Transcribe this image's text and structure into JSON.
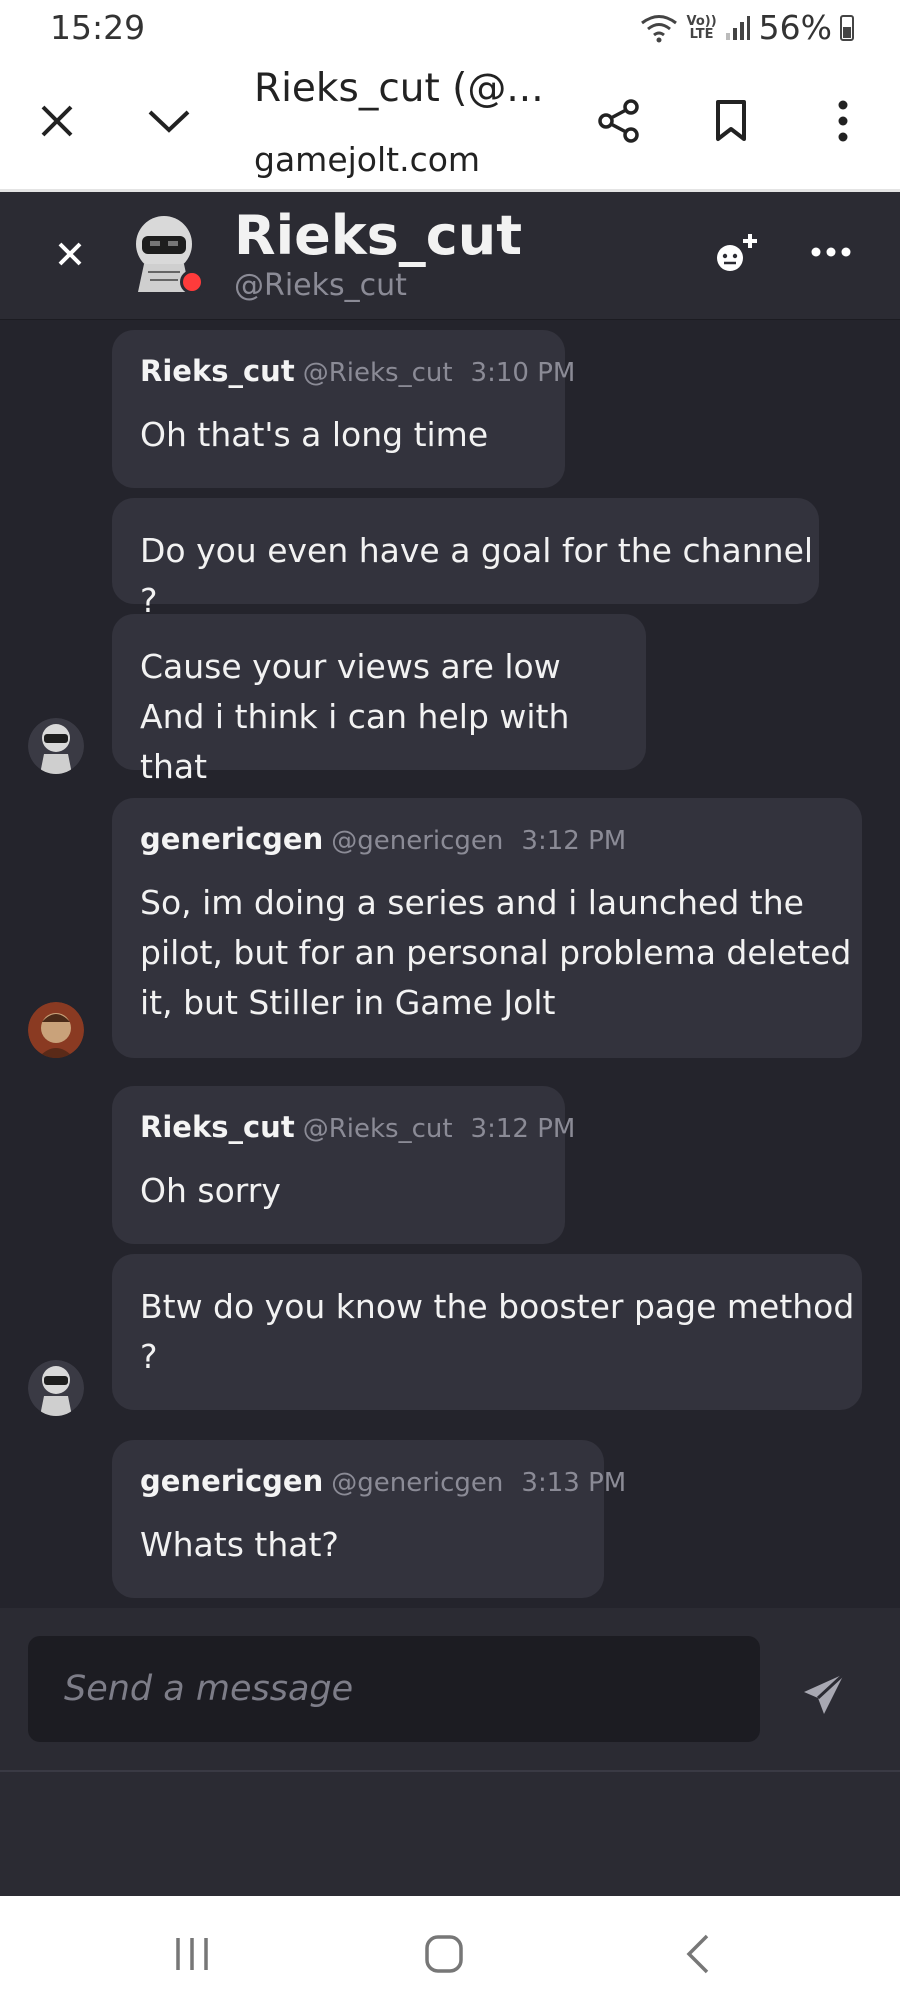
{
  "status_bar": {
    "time": "15:29",
    "network_label_top": "Vo))",
    "network_label_bottom": "LTE",
    "battery": "56%"
  },
  "browser": {
    "title": "Rieks_cut (@...",
    "url": "gamejolt.com"
  },
  "chat_header": {
    "name": "Rieks_cut",
    "handle": "@Rieks_cut"
  },
  "messages": [
    {
      "author": "Rieks_cut",
      "handle": "@Rieks_cut",
      "time": "3:10 PM",
      "text": "Oh that's a long time"
    },
    {
      "text": "Do you even have a goal for the channel ?"
    },
    {
      "text": "Cause your views are low\nAnd i think i can help with that"
    },
    {
      "author": "genericgen",
      "handle": "@genericgen",
      "time": "3:12 PM",
      "text": "So, im doing a series and i launched the\npilot, but for an personal problema deleted\nit, but Stiller in Game Jolt"
    },
    {
      "author": "Rieks_cut",
      "handle": "@Rieks_cut",
      "time": "3:12 PM",
      "text": "Oh sorry"
    },
    {
      "text": "Btw do you know the booster page method\n?"
    },
    {
      "author": "genericgen",
      "handle": "@genericgen",
      "time": "3:13 PM",
      "text": "Whats that?"
    }
  ],
  "composer": {
    "placeholder": "Send a message"
  },
  "colors": {
    "background": "#24242c",
    "bubble": "#33333d",
    "header": "#2b2b33",
    "online": "#ff3b3b"
  }
}
